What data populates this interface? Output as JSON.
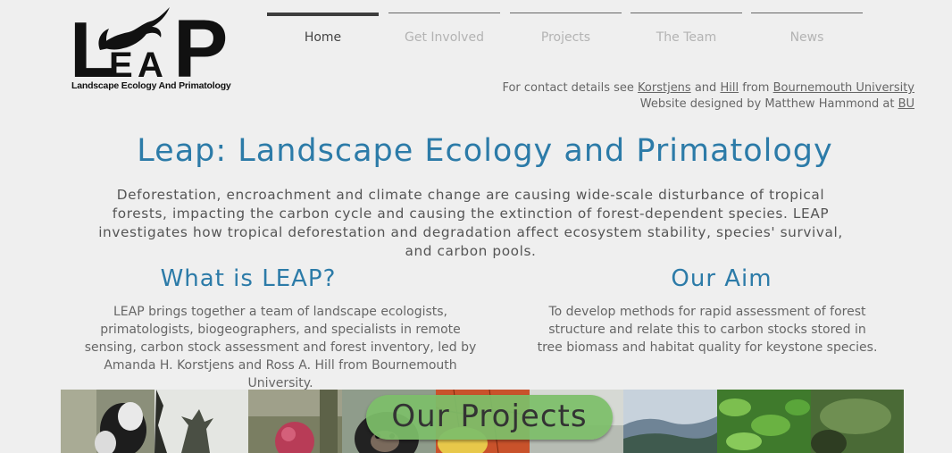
{
  "logo": {
    "wordmark": "LEAP",
    "caption": "Landscape Ecology And Primatology"
  },
  "nav": {
    "items": [
      {
        "label": "Home",
        "active": true
      },
      {
        "label": "Get Involved",
        "active": false
      },
      {
        "label": "Projects",
        "active": false
      },
      {
        "label": "The Team",
        "active": false
      },
      {
        "label": "News",
        "active": false
      }
    ]
  },
  "contact": {
    "line1_prefix": "For contact details see",
    "link_korstjens": "Korstjens",
    "and": "and",
    "link_hill": "Hill",
    "from": "from",
    "link_bu_full": "Bournemouth University",
    "line2_prefix": "Website designed by Matthew Hammond at",
    "link_bu": "BU"
  },
  "main": {
    "title": "Leap: Landscape Ecology and Primatology",
    "intro": "Deforestation, encroachment and climate change are causing wide-scale disturbance of tropical forests, impacting the carbon cycle and causing the extinction of forest-dependent species. LEAP investigates how tropical deforestation and degradation affect ecosystem stability, species' survival, and carbon pools.",
    "what_title": "What is LEAP?",
    "what_text": "LEAP brings together a team of landscape ecologists, primatologists, biogeographers, and specialists in remote sensing, carbon stock assessment and forest inventory, led by Amanda H. Korstjens and Ross A. Hill from Bournemouth University.",
    "aim_title": "Our Aim",
    "aim_text": "To develop methods for rapid assessment of forest structure and relate this to carbon stocks stored in tree biomass and habitat quality for keystone species."
  },
  "strip": {
    "button_label": "Our Projects",
    "photos": [
      "colobus-monkey-photo",
      "tree-silhouette-photo",
      "red-flower-photo",
      "chimpanzee-photo",
      "map-photo",
      "forest-light-photo",
      "hills-photo",
      "green-leaves-photo",
      "gorilla-forest-photo"
    ]
  },
  "colors": {
    "title_blue": "#2c7ba8",
    "button_green": "#7dbe69",
    "background": "#efefef"
  }
}
